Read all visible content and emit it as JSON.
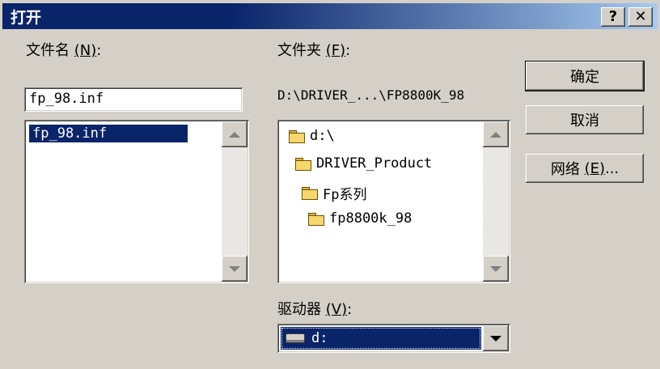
{
  "window": {
    "title": "打开",
    "help_btn": "?",
    "close_btn": "✕"
  },
  "file_name": {
    "label": "文件名",
    "accel": "(N)",
    "colon": ":",
    "value": "fp_98.inf",
    "list_items": [
      "fp_98.inf"
    ]
  },
  "folders": {
    "label": "文件夹",
    "accel": "(F)",
    "colon": ":",
    "current_path": "D:\\DRIVER_...\\FP8800K_98",
    "tree": [
      "d:\\",
      "DRIVER_Product",
      "Fp系列",
      "fp8800k_98"
    ]
  },
  "drives": {
    "label": "驱动器",
    "accel": "(V)",
    "colon": ":",
    "selected": "d:"
  },
  "buttons": {
    "ok": "确定",
    "cancel": "取消",
    "network": "网络",
    "network_accel": "(E)",
    "network_suffix": "..."
  },
  "colors": {
    "titlebar_start": "#0a246a",
    "titlebar_end": "#a6caf0",
    "selection": "#0a246a",
    "face": "#d4d0c8"
  }
}
